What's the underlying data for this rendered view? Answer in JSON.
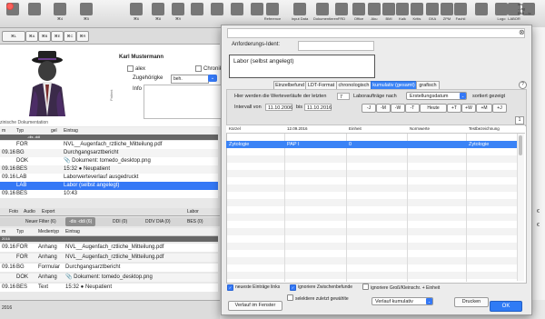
{
  "toolbar": {
    "items": [
      {
        "label": "",
        "icon": "folder-icon"
      },
      {
        "label": "",
        "icon": "person-icon"
      },
      {
        "label": "⌘4",
        "icon": "calendar-icon"
      },
      {
        "label": "⌘5",
        "icon": "flag-icon"
      },
      {
        "label": "⌘6",
        "icon": "grid-icon"
      },
      {
        "label": "⌘8",
        "icon": "document-icon"
      },
      {
        "label": "⌘9",
        "icon": "pen-icon"
      },
      {
        "label": "",
        "icon": "timer-icon"
      },
      {
        "label": "",
        "icon": "chart-icon"
      },
      {
        "label": "",
        "icon": "user-icon"
      },
      {
        "label": "",
        "icon": "clock-icon"
      },
      {
        "label": "Reference",
        "icon": "globe-icon"
      },
      {
        "label": "Input Data",
        "icon": "input-icon"
      },
      {
        "label": "Dokumentieren",
        "icon": "book-icon"
      },
      {
        "label": "FRD",
        "icon": "frd-icon"
      },
      {
        "label": "Office",
        "icon": "office-icon"
      },
      {
        "label": "Aku",
        "icon": "aku-icon"
      },
      {
        "label": "BMI",
        "icon": "bmi-icon"
      },
      {
        "label": "Kalk",
        "icon": "kalk-icon"
      },
      {
        "label": "Kritis",
        "icon": "kritis-icon"
      },
      {
        "label": "GKA",
        "icon": "gka-icon"
      },
      {
        "label": "ZPM",
        "icon": "zpm-icon"
      },
      {
        "label": "Fachli",
        "icon": "fachli-icon"
      },
      {
        "label": "",
        "icon": "chevron-icon"
      },
      {
        "label": "Logo",
        "icon": "logo-icon"
      },
      {
        "label": "LABOR",
        "icon": "labor-icon"
      },
      {
        "label": "",
        "icon": "envelope-icon"
      }
    ],
    "right_text": "ow\n– ag\nBMI – ic"
  },
  "secbar": {
    "buttons": [
      "⌘L",
      "⌘A",
      "⌘B",
      "⌘E",
      "⌘C",
      "⌘R"
    ]
  },
  "patient": {
    "side_label": "Patient",
    "name": "Karl Mustermann",
    "checkbox_1": "alex",
    "checkbox_2": "Chronik",
    "zugehoerigkeit_label": "Zugehörigke",
    "zugehoerigkeit_value": "beh.",
    "info_label": "Info"
  },
  "doc_section_label": "zinische Dokumentation",
  "list1": {
    "headers": [
      "m",
      "Typ",
      "gel",
      "Eintrag"
    ],
    "filter_label": "-dis -ddi",
    "rows": [
      {
        "date": "",
        "typ": "FOR",
        "text": "NVL__Augenfach_rztliche_Mitteilung.pdf"
      },
      {
        "date": "09.16",
        "typ": "BG",
        "text": "Durchgangsarztbericht"
      },
      {
        "date": "",
        "typ": "DOK",
        "text": "📎 Dokument: tomedo_desktop.png"
      },
      {
        "date": "09.16",
        "typ": "BES",
        "text": "15:32 ● Neupatient"
      },
      {
        "date": "09.16",
        "typ": "LAB",
        "text": "Laborwerteverlauf ausgedruckt"
      },
      {
        "date": "",
        "typ": "LAB",
        "text": "Labor (selbst angelegt)"
      },
      {
        "date": "09.16",
        "typ": "BES",
        "text": "10:43"
      }
    ]
  },
  "tabs2": [
    "Foto",
    "Audio",
    "Export",
    "Labor"
  ],
  "filter_tabs": [
    "Neuer Filter (6)",
    "-dis -ddi (6)",
    "DDI (0)",
    "DDV DIA (0)",
    "BES (0)"
  ],
  "list2": {
    "headers": [
      "m",
      "Typ",
      "Medientyp",
      "Eintrag"
    ],
    "group_label": "2016",
    "rows": [
      {
        "date": "09.16",
        "typ": "FOR",
        "medium": "Anhang",
        "text": "NVL__Augenfach_rztliche_Mitteilung.pdf"
      },
      {
        "date": "",
        "typ": "FOR",
        "medium": "Anhang",
        "text": "NVL__Augenfach_rztliche_Mitteilung.pdf"
      },
      {
        "date": "09.16",
        "typ": "BG",
        "medium": "Formular",
        "text": "Durchgangsarztbericht"
      },
      {
        "date": "",
        "typ": "DOK",
        "medium": "Anhang",
        "text": "📎 Dokument: tomedo_desktop.png"
      },
      {
        "date": "09.16",
        "typ": "BES",
        "medium": "Text",
        "text": "15:32 ● Neupatient"
      }
    ]
  },
  "bottom_left_date": "2016",
  "right_peek": [
    "€",
    "€"
  ],
  "dialog": {
    "anforderungs_ident_label": "Anforderungs-Ident:",
    "anforderungs_ident_value": "",
    "labor_text": "Labor (selbst angelegt)",
    "tabs": [
      "Einzelbefund",
      "LDT-Format",
      "chronologisch",
      "kumulativ (gesamt)",
      "grafisch"
    ],
    "active_tab": "kumulativ (gesamt)",
    "help": "?",
    "settings": {
      "text_prefix": "Hier werden die Werteverläufe der letzten",
      "count": "7",
      "text_middle": "Laboraufträge nach",
      "sort_value": "Erstellungsdatum",
      "text_suffix": "sortiert gezeigt",
      "interval_label": "Intervall von",
      "from": "11.10.2006",
      "to_label": "bis",
      "to": "11.10.2016",
      "range_buttons": [
        "-J",
        "-M",
        "-W",
        "-T",
        "Heute",
        "+T",
        "+W",
        "+M",
        "+J"
      ],
      "page_number": "1"
    },
    "grid": {
      "headers": [
        "Kürzel",
        "12.09.2016",
        "Einheit",
        "Normwerte",
        "Testbezeichnung"
      ],
      "sub_headers": [
        "",
        "",
        "",
        "",
        ""
      ],
      "selected_row": [
        "Zytologie",
        "PAP I",
        "0",
        "",
        "Zytologie"
      ]
    },
    "checkboxes": [
      {
        "label": "neueste Einträge links",
        "checked": true
      },
      {
        "label": "ignoriere Zwischenbefunde",
        "checked": true
      },
      {
        "label": "ignoriere Groß/Kleinschr. + Einheit",
        "checked": false
      },
      {
        "label": "selektiere zuletzt gewählte",
        "checked": false
      }
    ],
    "buttons": {
      "verlauf": "Verlauf im Fenster",
      "kumulativ_select": "Verlauf kumulativ",
      "drucken": "Drucken",
      "ok": "OK"
    }
  },
  "colors": {
    "accent": "#3478f6",
    "selection": "#3a83f6",
    "close": "#fc605c"
  }
}
